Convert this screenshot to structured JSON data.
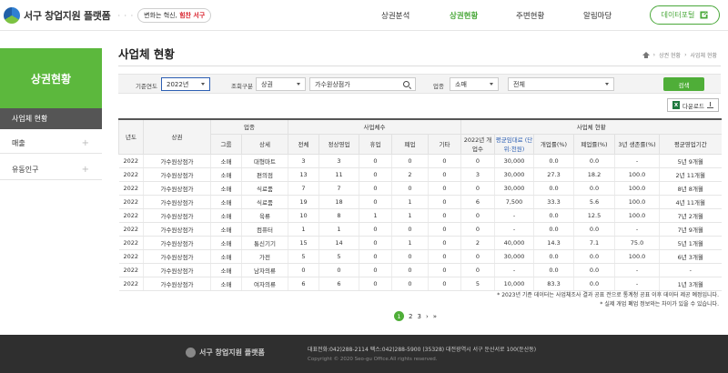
{
  "header": {
    "logo_text": "서구 창업지원 플랫폼",
    "slogan_prefix": "변화는 혁신, ",
    "slogan_accent": "힘찬 서구",
    "nav": [
      "상권분석",
      "상권현황",
      "주변현황",
      "알림마당"
    ],
    "portal_label": "데이터포털"
  },
  "sidebar": {
    "title": "상권현황",
    "items": [
      {
        "label": "사업체 현황",
        "active": true
      },
      {
        "label": "매출",
        "active": false
      },
      {
        "label": "유동인구",
        "active": false
      }
    ]
  },
  "page": {
    "title": "사업체 현황",
    "breadcrumb": [
      "상권 현황",
      "사업체 현황"
    ]
  },
  "filter": {
    "year_label": "기준연도",
    "year_value": "2022년",
    "type_label": "조회구분",
    "type_value": "상권",
    "area_value": "가수원상점가",
    "industry_label": "업종",
    "industry_value": "소매",
    "sub_value": "전체",
    "search_label": "검색",
    "download_label": "다운로드"
  },
  "table": {
    "head": {
      "year": "년도",
      "area": "상권",
      "industry": "업종",
      "business_count": "사업체수",
      "business_status": "사업체 현황",
      "group": "그룹",
      "detail": "상세",
      "total": "전체",
      "normal": "정상영업",
      "closed_temp": "휴업",
      "closed": "폐업",
      "etc": "기타",
      "opened": "2022년 개업수",
      "rent": "평균임대료 (단위:천원)",
      "open_rate": "개업률(%)",
      "close_rate": "폐업률(%)",
      "survival": "3년 생존률(%)",
      "period": "평균영업기간"
    },
    "rows": [
      [
        "2022",
        "가수원상점가",
        "소매",
        "대형마트",
        "3",
        "3",
        "0",
        "0",
        "0",
        "0",
        "30,000",
        "0.0",
        "0.0",
        "-",
        "5년 9개월"
      ],
      [
        "2022",
        "가수원상점가",
        "소매",
        "편의점",
        "13",
        "11",
        "0",
        "2",
        "0",
        "3",
        "30,000",
        "27.3",
        "18.2",
        "100.0",
        "2년 11개월"
      ],
      [
        "2022",
        "가수원상점가",
        "소매",
        "식료품",
        "7",
        "7",
        "0",
        "0",
        "0",
        "0",
        "30,000",
        "0.0",
        "0.0",
        "100.0",
        "8년 8개월"
      ],
      [
        "2022",
        "가수원상점가",
        "소매",
        "식료품",
        "19",
        "18",
        "0",
        "1",
        "0",
        "6",
        "7,500",
        "33.3",
        "5.6",
        "100.0",
        "4년 11개월"
      ],
      [
        "2022",
        "가수원상점가",
        "소매",
        "육류",
        "10",
        "8",
        "1",
        "1",
        "0",
        "0",
        "-",
        "0.0",
        "12.5",
        "100.0",
        "7년 2개월"
      ],
      [
        "2022",
        "가수원상점가",
        "소매",
        "컴퓨터",
        "1",
        "1",
        "0",
        "0",
        "0",
        "0",
        "-",
        "0.0",
        "0.0",
        "-",
        "7년 9개월"
      ],
      [
        "2022",
        "가수원상점가",
        "소매",
        "통신기기",
        "15",
        "14",
        "0",
        "1",
        "0",
        "2",
        "40,000",
        "14.3",
        "7.1",
        "75.0",
        "5년 1개월"
      ],
      [
        "2022",
        "가수원상점가",
        "소매",
        "가전",
        "5",
        "5",
        "0",
        "0",
        "0",
        "0",
        "30,000",
        "0.0",
        "0.0",
        "100.0",
        "6년 3개월"
      ],
      [
        "2022",
        "가수원상점가",
        "소매",
        "남자의류",
        "0",
        "0",
        "0",
        "0",
        "0",
        "0",
        "-",
        "0.0",
        "0.0",
        "-",
        "-"
      ],
      [
        "2022",
        "가수원상점가",
        "소매",
        "여자의류",
        "6",
        "6",
        "0",
        "0",
        "0",
        "5",
        "10,000",
        "83.3",
        "0.0",
        "-",
        "1년 3개월"
      ]
    ]
  },
  "notes": [
    "* 2023년 기준 데이터는 사업체조사 결과 공표 전으로 통계청 공표 이후 데이터 제공 예정입니다.",
    "* 실제 개업 폐업 정보와는 차이가 있을 수 있습니다."
  ],
  "pager": {
    "pages": [
      "1",
      "2",
      "3"
    ],
    "next": "›",
    "last": "»"
  },
  "footer": {
    "logo_text": "서구 창업지원 플랫폼",
    "contact": "대표전화:042)288-2114     팩스:042)288-5900     (35328) 대전광역시 서구 둔산서로 100(둔산동)",
    "copyright": "Copyright © 2020 Seo-gu Office.All rights reserved."
  }
}
